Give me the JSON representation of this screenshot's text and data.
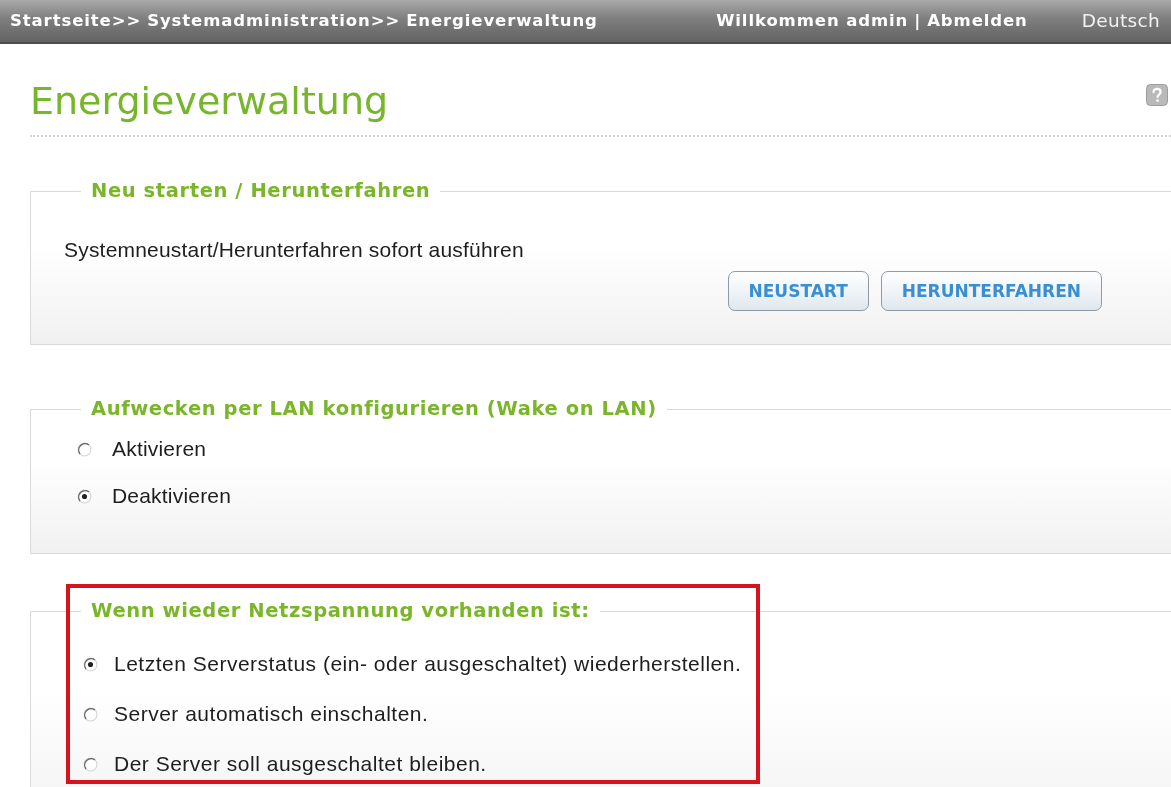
{
  "header": {
    "breadcrumb": [
      {
        "label": "Startseite",
        "separator": ">>"
      },
      {
        "label": "Systemadministration",
        "separator": ">>"
      },
      {
        "label": "Energieverwaltung"
      }
    ],
    "welcome": "Willkommen admin",
    "divider": "|",
    "logout": "Abmelden",
    "language": "Deutsch"
  },
  "page": {
    "title": "Energieverwaltung"
  },
  "sections": [
    {
      "kind": "buttons",
      "title": "Neu starten / Herunterfahren",
      "description": "Systemneustart/Herunterfahren sofort ausführen",
      "buttons": [
        "NEUSTART",
        "HERUNTERFAHREN"
      ],
      "highlighted": false
    },
    {
      "kind": "radios",
      "title": "Aufwecken per LAN konfigurieren (Wake on LAN)",
      "options": [
        {
          "label": "Aktivieren",
          "selected": false
        },
        {
          "label": "Deaktivieren",
          "selected": true
        }
      ],
      "highlighted": false
    },
    {
      "kind": "radios",
      "title": "Wenn wieder Netzspannung vorhanden ist:",
      "options": [
        {
          "label": "Letzten Serverstatus (ein- oder ausgeschaltet) wiederherstellen.",
          "selected": true
        },
        {
          "label": "Server automatisch einschalten.",
          "selected": false
        },
        {
          "label": "Der Server soll ausgeschaltet bleiben.",
          "selected": false
        }
      ],
      "highlighted": true
    }
  ]
}
